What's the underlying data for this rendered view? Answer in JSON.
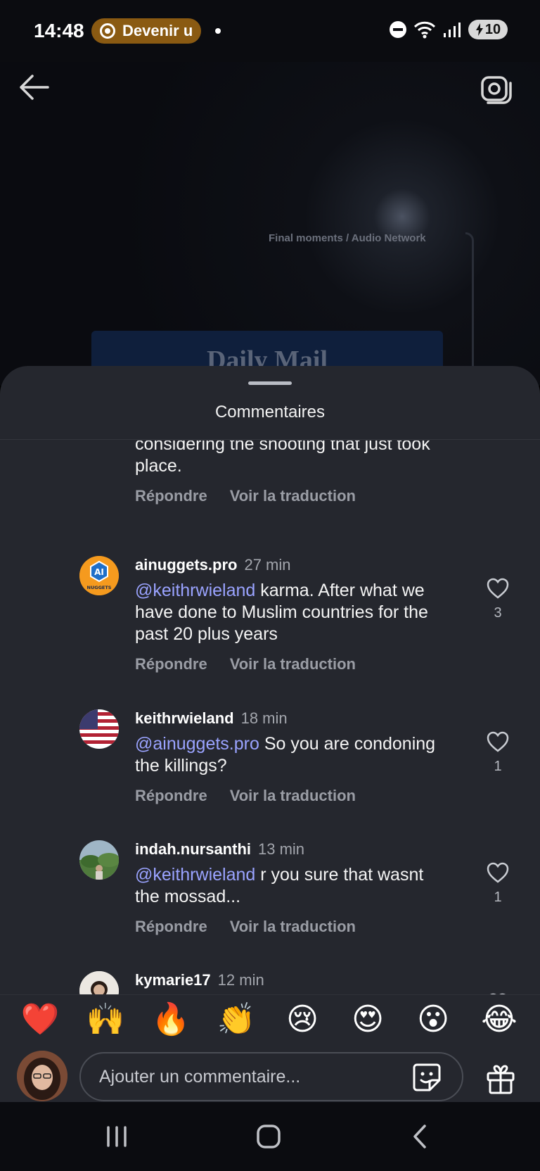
{
  "status_bar": {
    "time": "14:48",
    "pill_text": "Devenir u",
    "battery": "10",
    "colors": {
      "pill": "#8a5a12"
    }
  },
  "video": {
    "audio_credit": "Final moments / Audio Network",
    "overlay_brand": "Daily Mail"
  },
  "header": {
    "back_icon": "back-arrow-icon",
    "camera_icon": "camera-icon"
  },
  "sheet": {
    "title": "Commentaires"
  },
  "comments": [
    {
      "user": "",
      "time": "",
      "mention": "",
      "text": "considering the shooting that just took place.",
      "reply": "Répondre",
      "translate": "Voir la traduction",
      "likes": ""
    },
    {
      "user": "ainuggets.pro",
      "time": "27 min",
      "mention": "@keithrwieland",
      "text": " karma. After what we have done to Muslim countries for the past 20 plus years",
      "reply": "Répondre",
      "translate": "Voir la traduction",
      "likes": "3",
      "avatar_text": "AI",
      "avatar_subtext": "NUGGETS"
    },
    {
      "user": "keithrwieland",
      "time": "18 min",
      "mention": "@ainuggets.pro",
      "text": " So you are condoning the killings?",
      "reply": "Répondre",
      "translate": "Voir la traduction",
      "likes": "1"
    },
    {
      "user": "indah.nursanthi",
      "time": "13 min",
      "mention": "@keithrwieland",
      "text": " r you sure that wasnt the mossad...",
      "reply": "Répondre",
      "translate": "Voir la traduction",
      "likes": "1"
    },
    {
      "user": "kymarie17",
      "time": "12 min"
    }
  ],
  "emoji_reactions": [
    "❤️",
    "🙌",
    "🔥",
    "👏",
    "😢",
    "😍",
    "😮",
    "😂"
  ],
  "input": {
    "placeholder": "Ajouter un commentaire..."
  },
  "colors": {
    "sheet_bg": "#25272e",
    "mention": "#9aa3ff",
    "meta_text": "#9a9da5"
  }
}
